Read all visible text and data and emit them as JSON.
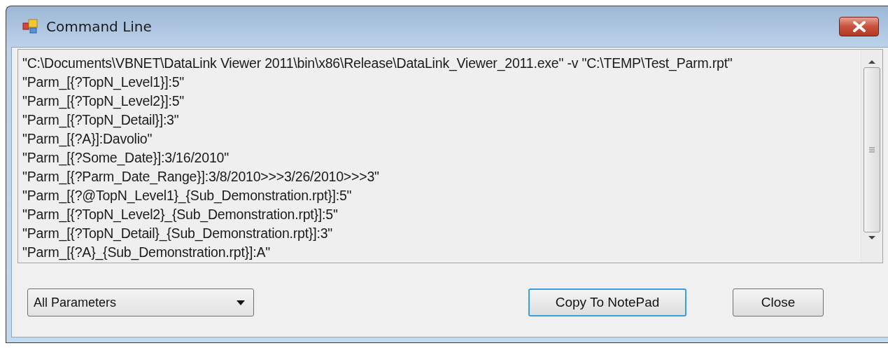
{
  "window": {
    "title": "Command Line"
  },
  "command_lines": [
    "\"C:\\Documents\\VBNET\\DataLink Viewer 2011\\bin\\x86\\Release\\DataLink_Viewer_2011.exe\" -v \"C:\\TEMP\\Test_Parm.rpt\"",
    "\"Parm_[{?TopN_Level1}]:5\"",
    "\"Parm_[{?TopN_Level2}]:5\"",
    "\"Parm_[{?TopN_Detail}]:3\"",
    "\"Parm_[{?A}]:Davolio\"",
    "\"Parm_[{?Some_Date}]:3/16/2010\"",
    "\"Parm_[{?Parm_Date_Range}]:3/8/2010>>>3/26/2010>>>3\"",
    "\"Parm_[{?@TopN_Level1}_{Sub_Demonstration.rpt}]:5\"",
    "\"Parm_[{?TopN_Level2}_{Sub_Demonstration.rpt}]:5\"",
    "\"Parm_[{?TopN_Detail}_{Sub_Demonstration.rpt}]:3\"",
    "\"Parm_[{?A}_{Sub_Demonstration.rpt}]:A\""
  ],
  "filter_dropdown": {
    "value": "All Parameters"
  },
  "buttons": [
    {
      "label": "Copy To NotePad",
      "focused": true
    },
    {
      "label": "Close",
      "focused": false
    }
  ]
}
